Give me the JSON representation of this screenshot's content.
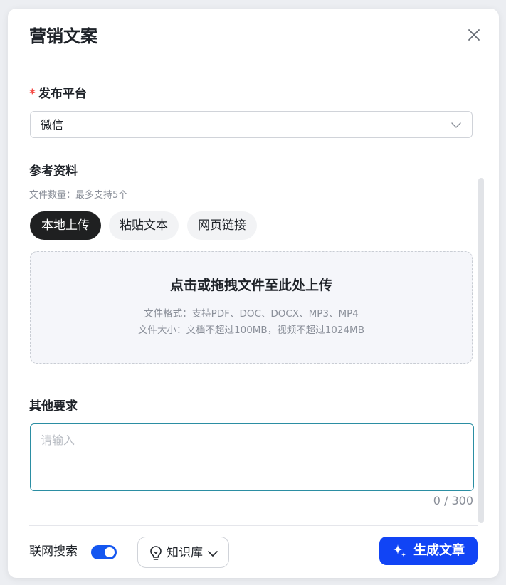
{
  "dialog": {
    "title": "营销文案",
    "close_icon": "close-icon"
  },
  "platform": {
    "required_mark": "*",
    "label": "发布平台",
    "selected": "微信",
    "caret_icon": "chevron-down-icon"
  },
  "reference": {
    "label": "参考资料",
    "hint": "文件数量：最多支持5个",
    "tabs": [
      {
        "label": "本地上传",
        "active": true
      },
      {
        "label": "粘贴文本",
        "active": false
      },
      {
        "label": "网页链接",
        "active": false
      }
    ],
    "dropzone": {
      "title": "点击或拖拽文件至此处上传",
      "formats": "文件格式：支持PDF、DOC、DOCX、MP3、MP4",
      "size": "文件大小：文档不超过100MB，视频不超过1024MB"
    }
  },
  "other": {
    "label": "其他要求",
    "placeholder": "请输入",
    "value": "",
    "counter": "0 / 300"
  },
  "footer": {
    "web_search_label": "联网搜索",
    "web_search_on": true,
    "knowledge_label": "知识库",
    "knowledge_icon": "lightbulb-icon",
    "generate_label": "生成文章",
    "generate_icon": "sparkle-icon"
  },
  "colors": {
    "accent": "#1144f5",
    "toggle_on": "#1456f0",
    "required": "#f54a45",
    "active_tab": "#1f2021",
    "input_focus": "#2b8ea3"
  }
}
